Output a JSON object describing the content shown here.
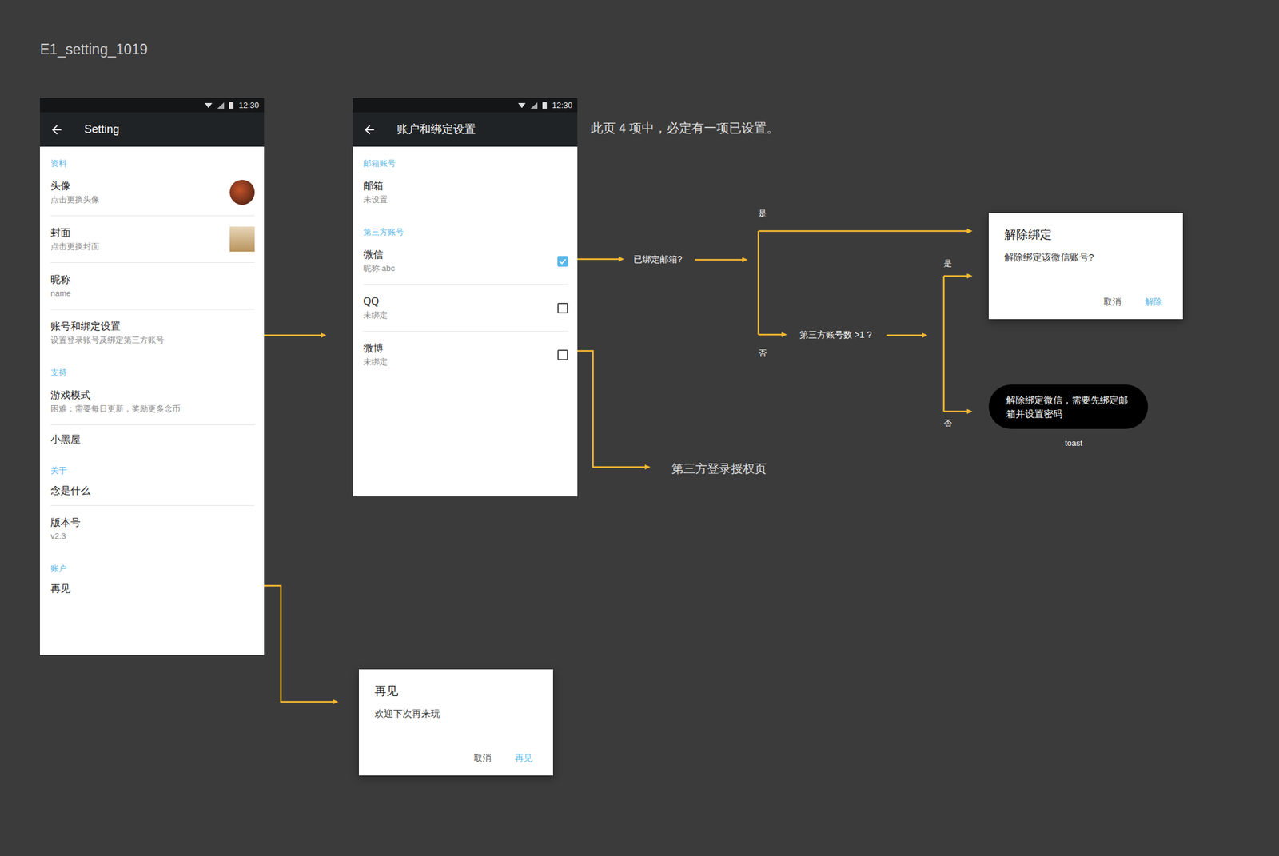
{
  "title": "E1_setting_1019",
  "settings_screen": {
    "status_bar": {
      "time": "12:30"
    },
    "toolbar": {
      "title": "Setting"
    },
    "sections": [
      {
        "header": "资料",
        "items": [
          {
            "title": "头像",
            "subtitle": "点击更换头像",
            "kind": "avatar"
          },
          {
            "title": "封面",
            "subtitle": "点击更换封面",
            "kind": "cover"
          },
          {
            "title": "昵称",
            "subtitle": "name",
            "kind": "plain"
          },
          {
            "title": "账号和绑定设置",
            "subtitle": "设置登录账号及绑定第三方账号",
            "kind": "plain"
          }
        ]
      },
      {
        "header": "支持",
        "items": [
          {
            "title": "游戏模式",
            "subtitle": "困难：需要每日更新，奖励更多念币",
            "kind": "plain"
          },
          {
            "title": "小黑屋",
            "subtitle": "",
            "kind": "plain"
          }
        ]
      },
      {
        "header": "关于",
        "items": [
          {
            "title": "念是什么",
            "subtitle": "",
            "kind": "plain"
          },
          {
            "title": "版本号",
            "subtitle": "v2.3",
            "kind": "plain"
          }
        ]
      },
      {
        "header": "账户",
        "items": [
          {
            "title": "再见",
            "subtitle": "",
            "kind": "plain"
          }
        ]
      }
    ]
  },
  "account_screen": {
    "status_bar": {
      "time": "12:30"
    },
    "toolbar": {
      "title": "账户和绑定设置"
    },
    "sections": [
      {
        "header": "邮箱账号",
        "items": [
          {
            "title": "邮箱",
            "subtitle": "未设置",
            "kind": "plain"
          }
        ]
      },
      {
        "header": "第三方账号",
        "items": [
          {
            "title": "微信",
            "subtitle": "昵称 abc",
            "kind": "checkbox",
            "checked": true
          },
          {
            "title": "QQ",
            "subtitle": "未绑定",
            "kind": "checkbox",
            "checked": false
          },
          {
            "title": "微博",
            "subtitle": "未绑定",
            "kind": "checkbox",
            "checked": false
          }
        ]
      }
    ]
  },
  "note": "此页 4 项中，必定有一项已设置。",
  "flow_labels": {
    "email_question": "已绑定邮箱?",
    "email_yes": "是",
    "email_no": "否",
    "count_question": "第三方账号数 >1 ?",
    "count_yes": "是",
    "count_no": "否"
  },
  "unbind_dialog": {
    "title": "解除绑定",
    "message": "解除绑定该微信账号?",
    "buttons": [
      "取消",
      "解除"
    ]
  },
  "toast": {
    "text": "解除绑定微信，需要先绑定邮箱并设置密码",
    "caption": "toast"
  },
  "auth_page_label": "第三方登录授权页",
  "bye_dialog": {
    "title": "再见",
    "message": "欢迎下次再来玩",
    "buttons": [
      "取消",
      "再见"
    ]
  }
}
